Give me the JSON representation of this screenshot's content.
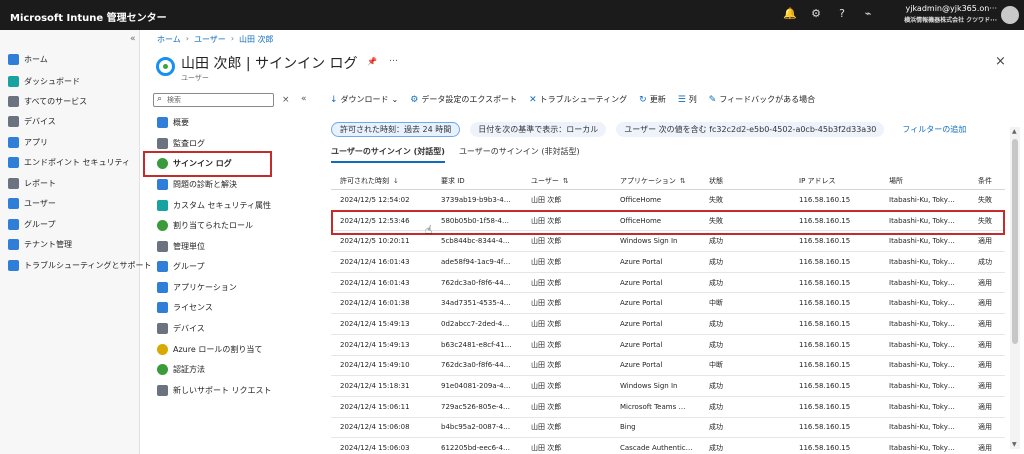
{
  "topbar": {
    "title": "Microsoft Intune 管理センター",
    "account_email": "yjkadmin@yjk365.on···",
    "account_org": "横浜情報機器株式会社  クツワド···"
  },
  "leftnav": {
    "items": [
      {
        "label": "ホーム",
        "icon": "home-icon"
      },
      {
        "label": "ダッシュボード",
        "icon": "dashboard-icon"
      },
      {
        "label": "すべてのサービス",
        "icon": "all-services-icon"
      },
      {
        "label": "デバイス",
        "icon": "devices-icon"
      },
      {
        "label": "アプリ",
        "icon": "apps-icon"
      },
      {
        "label": "エンドポイント セキュリティ",
        "icon": "shield-icon"
      },
      {
        "label": "レポート",
        "icon": "reports-icon"
      },
      {
        "label": "ユーザー",
        "icon": "users-icon"
      },
      {
        "label": "グループ",
        "icon": "groups-icon"
      },
      {
        "label": "テナント管理",
        "icon": "tenant-icon"
      },
      {
        "label": "トラブルシューティングとサポート",
        "icon": "troubleshoot-icon"
      }
    ]
  },
  "breadcrumb": [
    "ホーム",
    "ユーザー",
    "山田 次郎"
  ],
  "page": {
    "title": "山田 次郎 | サインイン ログ",
    "subtitle": "ユーザー"
  },
  "search": {
    "placeholder": "検索"
  },
  "subnav": [
    {
      "label": "概要",
      "icon": "person-icon"
    },
    {
      "label": "監査ログ",
      "icon": "audit-log-icon"
    },
    {
      "label": "サインイン ログ",
      "icon": "signin-log-icon",
      "selected": true
    },
    {
      "label": "問題の診断と解決",
      "icon": "diagnose-icon"
    },
    {
      "label": "カスタム セキュリティ属性",
      "icon": "security-attributes-icon"
    },
    {
      "label": "割り当てられたロール",
      "icon": "roles-icon"
    },
    {
      "label": "管理単位",
      "icon": "admin-units-icon"
    },
    {
      "label": "グループ",
      "icon": "groups-icon"
    },
    {
      "label": "アプリケーション",
      "icon": "applications-icon"
    },
    {
      "label": "ライセンス",
      "icon": "licenses-icon"
    },
    {
      "label": "デバイス",
      "icon": "devices-icon"
    },
    {
      "label": "Azure ロールの割り当て",
      "icon": "azure-roles-icon"
    },
    {
      "label": "認証方法",
      "icon": "auth-methods-icon"
    },
    {
      "label": "新しいサポート リクエスト",
      "icon": "support-icon"
    }
  ],
  "toolbar": {
    "download": "ダウンロード",
    "export": "データ設定のエクスポート",
    "troubleshoot": "トラブルシューティング",
    "refresh": "更新",
    "columns": "列",
    "feedback": "フィードバックがある場合"
  },
  "filters": {
    "time": "許可された時刻：過去 24 時間",
    "date_basis": "日付を次の基準で表示：ローカル",
    "user_filter": "ユーザー 次の値を含む fc32c2d2-e5b0-4502-a0cb-45b3f2d33a30",
    "add": "フィルターの追加"
  },
  "tabs": [
    "ユーザーのサインイン (対話型)",
    "ユーザーのサインイン (非対話型)"
  ],
  "table": {
    "headers": [
      "許可された時刻",
      "要求 ID",
      "ユーザー",
      "アプリケーション",
      "状態",
      "IP アドレス",
      "場所",
      "条件"
    ],
    "rows": [
      [
        "2024/12/5 12:54:02",
        "3739ab19-b9b3-4…",
        "山田 次郎",
        "OfficeHome",
        "失敗",
        "116.58.160.15",
        "Itabashi-Ku, Toky…",
        "失敗"
      ],
      [
        "2024/12/5 12:53:46",
        "580b05b0-1f58-4…",
        "山田 次郎",
        "OfficeHome",
        "失敗",
        "116.58.160.15",
        "Itabashi-Ku, Toky…",
        "失敗"
      ],
      [
        "2024/12/5 10:20:11",
        "5cb844bc-8344-4…",
        "山田 次郎",
        "Windows Sign In",
        "成功",
        "116.58.160.15",
        "Itabashi-Ku, Toky…",
        "適用"
      ],
      [
        "2024/12/4 16:01:43",
        "ade58f94-1ac9-4f…",
        "山田 次郎",
        "Azure Portal",
        "成功",
        "116.58.160.15",
        "Itabashi-Ku, Toky…",
        "成功"
      ],
      [
        "2024/12/4 16:01:43",
        "762dc3a0-f8f6-44…",
        "山田 次郎",
        "Azure Portal",
        "成功",
        "116.58.160.15",
        "Itabashi-Ku, Toky…",
        "適用"
      ],
      [
        "2024/12/4 16:01:38",
        "34ad7351-4535-4…",
        "山田 次郎",
        "Azure Portal",
        "中断",
        "116.58.160.15",
        "Itabashi-Ku, Toky…",
        "適用"
      ],
      [
        "2024/12/4 15:49:13",
        "0d2abcc7-2ded-4…",
        "山田 次郎",
        "Azure Portal",
        "成功",
        "116.58.160.15",
        "Itabashi-Ku, Toky…",
        "適用"
      ],
      [
        "2024/12/4 15:49:13",
        "b63c2481-e8cf-41…",
        "山田 次郎",
        "Azure Portal",
        "成功",
        "116.58.160.15",
        "Itabashi-Ku, Toky…",
        "適用"
      ],
      [
        "2024/12/4 15:49:10",
        "762dc3a0-f8f6-44…",
        "山田 次郎",
        "Azure Portal",
        "中断",
        "116.58.160.15",
        "Itabashi-Ku, Toky…",
        "適用"
      ],
      [
        "2024/12/4 15:18:31",
        "91e04081-209a-4…",
        "山田 次郎",
        "Windows Sign In",
        "成功",
        "116.58.160.15",
        "Itabashi-Ku, Toky…",
        "適用"
      ],
      [
        "2024/12/4 15:06:11",
        "729ac526-805e-4…",
        "山田 次郎",
        "Microsoft Teams …",
        "成功",
        "116.58.160.15",
        "Itabashi-Ku, Toky…",
        "適用"
      ],
      [
        "2024/12/4 15:06:08",
        "b4bc95a2-0087-4…",
        "山田 次郎",
        "Bing",
        "成功",
        "116.58.160.15",
        "Itabashi-Ku, Toky…",
        "適用"
      ],
      [
        "2024/12/4 15:06:03",
        "612205bd-eec6-4…",
        "山田 次郎",
        "Cascade Authentic…",
        "成功",
        "116.58.160.15",
        "Itabashi-Ku, Toky…",
        "適用"
      ]
    ]
  },
  "colors": {
    "topbar": "#1b1b1b",
    "accent": "#0f6cbd",
    "highlight_border": "#c42b2b"
  }
}
